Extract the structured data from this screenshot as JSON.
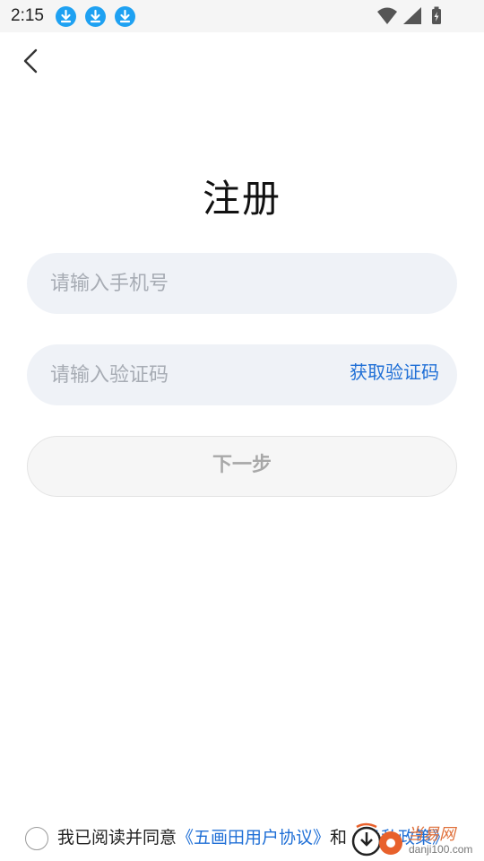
{
  "status_bar": {
    "time": "2:15",
    "icons": [
      "download-icon",
      "download-icon",
      "download-icon",
      "wifi-icon",
      "signal-icon",
      "battery-icon"
    ]
  },
  "header": {
    "back_icon": "chevron-left-icon"
  },
  "page": {
    "title": "注册"
  },
  "form": {
    "phone_placeholder": "请输入手机号",
    "code_placeholder": "请输入验证码",
    "get_code_label": "获取验证码",
    "next_label": "下一步"
  },
  "agreement": {
    "prefix": "我已阅读并同意",
    "user_agreement": "《五画田用户协议》",
    "and": "和",
    "privacy_policy": "《隐私政策》"
  },
  "watermark": {
    "cn": "当易网",
    "url": "danji100.com"
  },
  "colors": {
    "accent": "#1f6fd6",
    "download_badge": "#1ea1f2",
    "field_bg": "#eff2f7",
    "disabled_button_bg": "#f6f6f6",
    "disabled_button_text": "#a8a8a8"
  }
}
